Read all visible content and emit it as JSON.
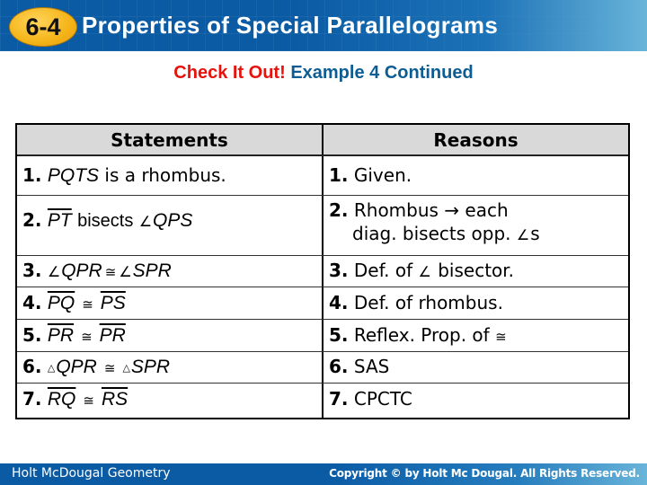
{
  "header": {
    "section_badge": "6-4",
    "title": "Properties of Special Parallelograms",
    "badge_color": "#f5b418",
    "banner_color": "#0a5aa4"
  },
  "subtitle": {
    "highlight": "Check It Out!",
    "text": "Example 4 Continued",
    "highlight_color": "#e8120c",
    "text_color": "#0c5d93"
  },
  "table": {
    "headers": {
      "statements": "Statements",
      "reasons": "Reasons"
    },
    "rows": [
      {
        "num": "1.",
        "statement": {
          "italic": "PQTS",
          "rest": " is a rhombus."
        },
        "reason": {
          "text": "Given."
        }
      },
      {
        "num": "2.",
        "statement": {
          "segment": "PT",
          "verb": "bisects",
          "angle_symbol": "∠",
          "angle": "QPS"
        },
        "reason": {
          "line1": "Rhombus → each",
          "line2": "diag. bisects opp. ",
          "angle_symbol": "∠",
          "suffix": "s"
        }
      },
      {
        "num": "3.",
        "statement": {
          "angle_symbol": "∠",
          "left": "QPR",
          "congruent": "≅",
          "right": "SPR"
        },
        "reason": {
          "prefix": "Def. of ",
          "angle_symbol": "∠",
          "suffix": " bisector."
        }
      },
      {
        "num": "4.",
        "statement": {
          "left": "PQ",
          "congruent": "≅",
          "right": "PS"
        },
        "reason": {
          "text": "Def. of rhombus."
        }
      },
      {
        "num": "5.",
        "statement": {
          "left": "PR",
          "congruent": "≅",
          "right": "PR"
        },
        "reason": {
          "prefix": "Reflex. Prop. of ",
          "congruent": "≅"
        }
      },
      {
        "num": "6.",
        "statement": {
          "triangle_symbol": "△",
          "left": "QPR",
          "congruent": "≅",
          "right": "SPR"
        },
        "reason": {
          "text": "SAS"
        }
      },
      {
        "num": "7.",
        "statement": {
          "left": "RQ",
          "congruent": "≅",
          "right": "RS"
        },
        "reason": {
          "text": "CPCTC"
        }
      }
    ]
  },
  "footer": {
    "left": "Holt McDougal Geometry",
    "right": "Copyright © by Holt Mc Dougal. All Rights Reserved."
  }
}
